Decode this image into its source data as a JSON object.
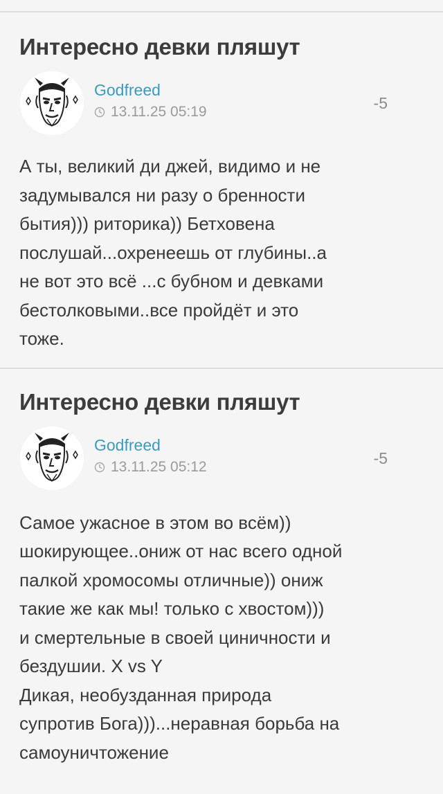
{
  "posts": [
    {
      "title": "Интересно девки пляшут",
      "author": "Godfreed",
      "timestamp": "13.11.25 05:19",
      "score": "-5",
      "body": "А ты, великий ди джей, видимо и не\nзадумывался ни разу о бренности\nбытия))) риторика)) Бетховена\nпослушай...охренеешь от глубины..а\nне вот это всё ...с бубном и девками\nбестолковыми..все пройдёт и это\nтоже."
    },
    {
      "title": "Интересно девки пляшут",
      "author": "Godfreed",
      "timestamp": "13.11.25 05:12",
      "score": "-5",
      "body": "Самое ужасное в этом во всём))\nшокирующее..ониж от нас всего одной\nпалкой хромосомы отличные)) ониж\nтакие же как мы! только с хвостом)))\nи смертельные в своей циничности и\nбездушии. X vs Y\nДикая, необузданная природа\nсупротив Бога)))...неравная борьба на\nсамоуничтожение"
    }
  ],
  "icons": {
    "avatar": "devil-face-avatar-icon",
    "clock": "clock-icon"
  }
}
